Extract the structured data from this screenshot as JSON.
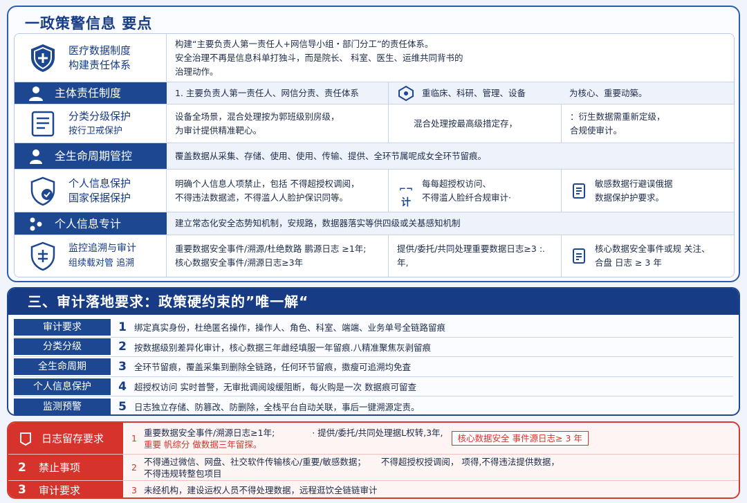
{
  "sec1": {
    "title": "一政策警信息  要点",
    "rows": [
      {
        "left": [
          "医疗数据制度",
          "构建责任体系"
        ],
        "right": [
          "构建“主要负责人第一责任人+网信导小组・部门分工”的责任体系。",
          "安全治理不再是信息科单打独斗，而是院长、 科室、医生、运维共同背书的",
          "治理动作。"
        ]
      },
      {
        "left": [
          "主体责任制度"
        ],
        "cells": [
          "1. 主要负责人第一责任人、网信分责、责任体系",
          "重临床、科研、管理、设备",
          "为核心、重要动築。"
        ]
      },
      {
        "left": [
          "分类分级保护",
          "按行卫戒保护"
        ],
        "cells": [
          "设备全场景，混合处理按为郭班级别房级，\n为审计提供精准靶心。",
          "混合处理按最高级措定存，",
          "：衍生数据需重新定级，\n合规使审计。"
        ]
      },
      {
        "left": [
          "全生命周期管控"
        ],
        "cells": [
          "覆盖数据从采集、存储、使用、使用、传输、提供、全环节属呢成女全环节留痕。"
        ]
      },
      {
        "left": [
          "个人信息保护",
          "国家保据保护"
        ],
        "cells": [
          "明确个人信息人项禁止，包括 不得超授权调阅，\n不得违法数据滤，不得滥人人脸护保识同等。",
          "每每超授权访问、\n不得滥人脸纤合规审计·",
          "敏感数据行避误俄据\n数据保护护要求。"
        ],
        "cell2icon": "计"
      },
      {
        "left": [
          "个人信息专计"
        ],
        "cells": [
          "建立常态化安全态势知机制，安规路，数据器落实等供四级或关基感知机制"
        ]
      },
      {
        "left": [
          "监控追溯与审计",
          "组续载对管 追溯"
        ],
        "cells": [
          "重要数据安全事件/溯源/杜绝数路 鹏源日志 ≥1年;\n核心数据安全事件/溯源日志≥3年",
          "提供/委托/共同处理重要数据日志≥3 :. 年,",
          "核心数据安全事件或规 关注、\n合盘 日志 ≥ 3 年"
        ]
      }
    ]
  },
  "sec2": {
    "title": "三、审计落地要求：政策硬约束的”唯一解“",
    "rows": [
      {
        "label": "审计要求",
        "num": "1",
        "text": "绑定真实身份，杜绝匿名操作，操作人、角色、科室、端端、业务单号全链路留痕"
      },
      {
        "label": "分类分级",
        "num": "2",
        "text": "按数据级别差异化审计，核心数据三年雌经填服一年留痕.八精准聚焦灰剥留痕"
      },
      {
        "label": "全生命周期",
        "num": "3",
        "text": "全环节留痕，覆盖采集到删除全链路，任何环节留痕，擞瘦可追溯均免査"
      },
      {
        "label": "个人信息保护",
        "num": "4",
        "text": "超授权访问 实时普警，无审批调阅竣缓阻断，每火购是一次 数据痕可留查"
      },
      {
        "label": "监测预警",
        "num": "5",
        "text": "日志独立存储、防篡改、防删除，全栈平台自动关联，事后一键溯源定责。"
      }
    ]
  },
  "sec3": {
    "rows": [
      {
        "num": "",
        "label": "日志留存要求",
        "rnum": "1",
        "line1a": "重要数据安全事件/溯源日志≥1年;",
        "line1b": "·  提供/委托/共同处理据L权转,3年,",
        "line2": "重要 帆综分 做数据三年留探。",
        "box": "核心数据安全 事件源日志≥ 3 年"
      },
      {
        "num": "2",
        "label": "禁止事项",
        "rnum": "2",
        "line1a": "不得通过微信、网盘、社交软件传输核心/重要/敏感数据；",
        "line1b": "不得超授权授调阅， 项得,不得违法提供数据，",
        "line2": "不得违规转整包项目"
      },
      {
        "num": "3",
        "label": "审计要求",
        "rnum": "3",
        "line1a": "未经机构，建设运权人员不得处理数据，远程逛饮全链链审计"
      }
    ]
  },
  "colors": {
    "navy": "#173b85",
    "band": "#1d4790",
    "red": "#d6332c"
  }
}
